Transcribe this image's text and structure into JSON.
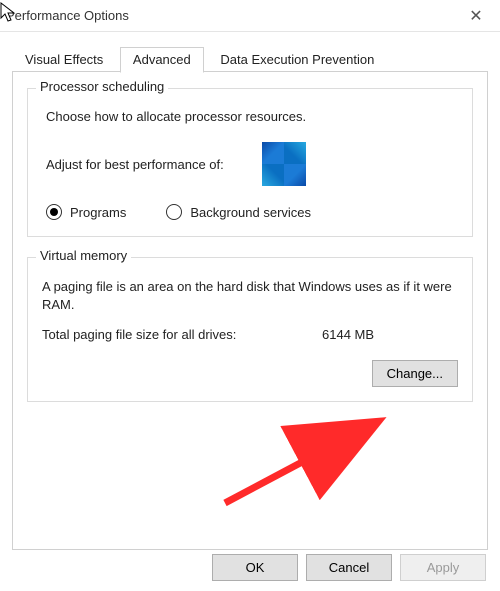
{
  "window": {
    "title": "Performance Options"
  },
  "tabs": {
    "visual_effects": "Visual Effects",
    "advanced": "Advanced",
    "dep": "Data Execution Prevention"
  },
  "processor_scheduling": {
    "legend": "Processor scheduling",
    "description": "Choose how to allocate processor resources.",
    "adjust_label": "Adjust for best performance of:",
    "programs_label": "Programs",
    "background_label": "Background services"
  },
  "virtual_memory": {
    "legend": "Virtual memory",
    "description": "A paging file is an area on the hard disk that Windows uses as if it were RAM.",
    "total_label": "Total paging file size for all drives:",
    "total_value": "6144 MB",
    "change_label": "Change..."
  },
  "buttons": {
    "ok": "OK",
    "cancel": "Cancel",
    "apply": "Apply"
  }
}
